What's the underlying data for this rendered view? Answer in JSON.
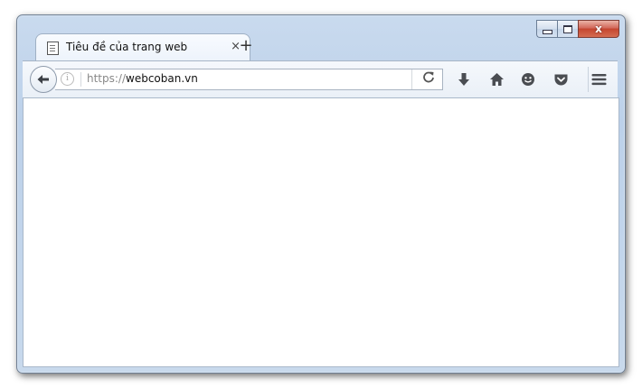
{
  "tab": {
    "title": "Tiêu đề của trang web",
    "close_glyph": "×",
    "icon": "page-icon"
  },
  "new_tab_glyph": "+",
  "urlbar": {
    "scheme": "https://",
    "host": "webcoban.vn",
    "info_glyph": "i",
    "reload_glyph": "C"
  },
  "window_buttons": {
    "close_glyph": "x"
  },
  "toolbar_icons": [
    "back-arrow-icon",
    "download-icon",
    "home-icon",
    "smiley-icon",
    "pocket-icon",
    "menu-icon"
  ],
  "colors": {
    "frame": "#c9daee",
    "close_button": "#c4452f",
    "toolbar_icon": "#4a4d52"
  }
}
